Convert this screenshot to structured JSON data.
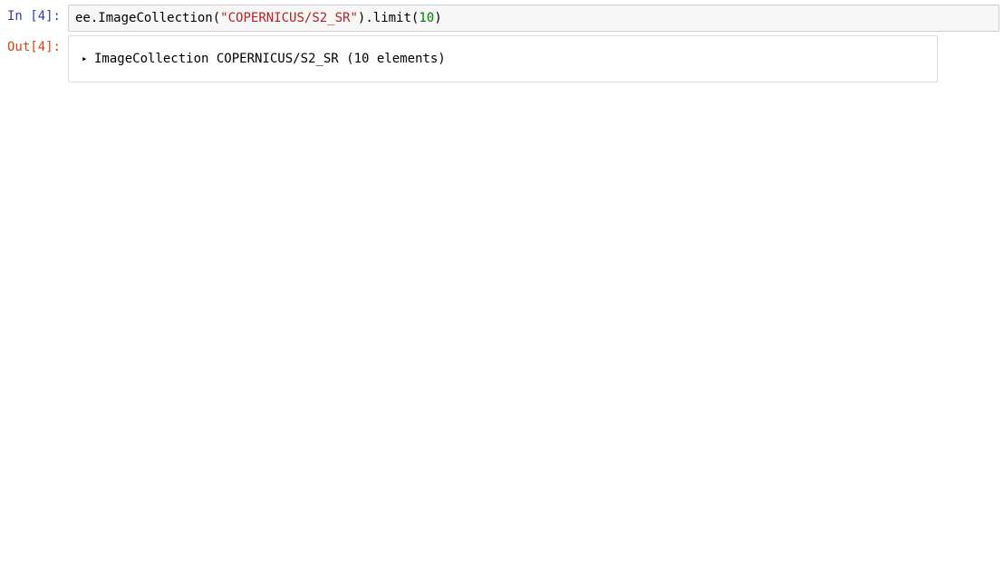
{
  "input": {
    "prompt": "In [4]:",
    "code": {
      "t1": "ee",
      "t2": ".",
      "t3": "ImageCollection",
      "t4": "(",
      "t5": "\"COPERNICUS/S2_SR\"",
      "t6": ")",
      "t7": ".",
      "t8": "limit",
      "t9": "(",
      "t10": "10",
      "t11": ")"
    }
  },
  "output": {
    "prompt": "Out[4]:",
    "tree": {
      "arrow": "▸",
      "label": "ImageCollection COPERNICUS/S2_SR (10 elements)"
    }
  }
}
